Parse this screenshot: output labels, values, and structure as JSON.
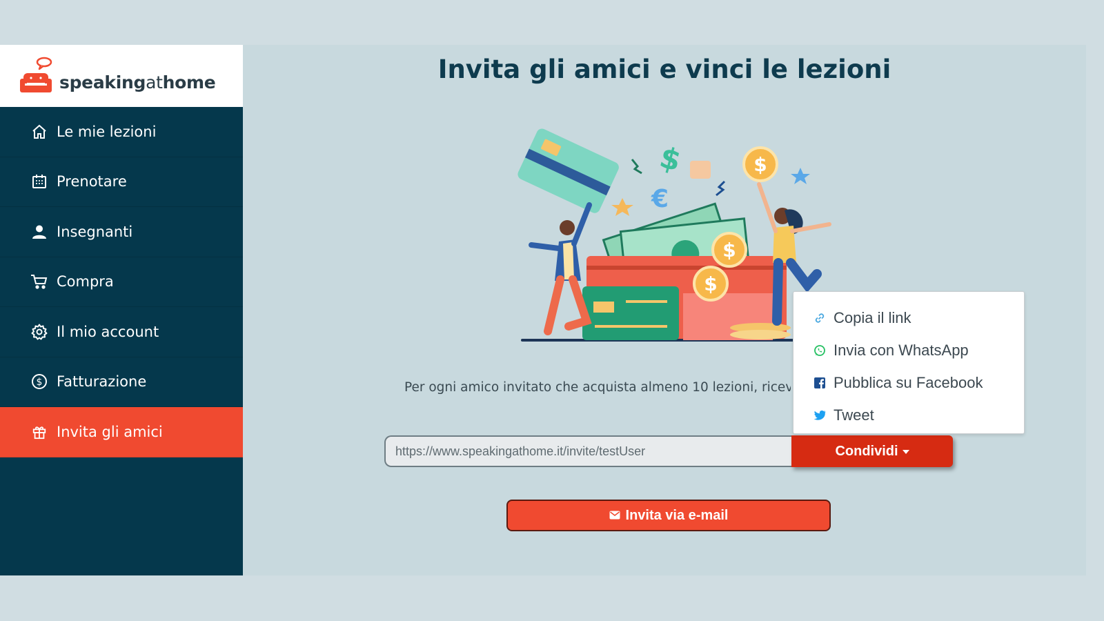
{
  "brand": {
    "logo_text_part1": "speaking",
    "logo_text_part2": "at",
    "logo_text_part3": "home",
    "accent_color": "#f04a30",
    "sidebar_color": "#05384c"
  },
  "sidebar": {
    "items": [
      {
        "label": "Le mie lezioni",
        "icon": "home-icon"
      },
      {
        "label": "Prenotare",
        "icon": "calendar-icon"
      },
      {
        "label": "Insegnanti",
        "icon": "user-icon"
      },
      {
        "label": "Compra",
        "icon": "cart-icon"
      },
      {
        "label": "Il mio account",
        "icon": "gear-icon"
      },
      {
        "label": "Fatturazione",
        "icon": "dollar-circle-icon"
      },
      {
        "label": "Invita gli amici",
        "icon": "gift-icon",
        "active": true
      }
    ]
  },
  "main": {
    "title": "Invita gli amici e vinci le lezioni",
    "info_text": "Per ogni amico invitato che acquista almeno 10 lezioni, ricev",
    "invite_url": "https://www.speakingathome.it/invite/testUser",
    "share_label": "Condividi",
    "invite_email_label": "Invita via e-mail"
  },
  "share_menu": {
    "items": [
      {
        "label": "Copia il link",
        "icon": "link-icon"
      },
      {
        "label": "Invia con WhatsApp",
        "icon": "whatsapp-icon"
      },
      {
        "label": "Pubblica su Facebook",
        "icon": "facebook-icon"
      },
      {
        "label": "Tweet",
        "icon": "twitter-icon"
      }
    ]
  }
}
